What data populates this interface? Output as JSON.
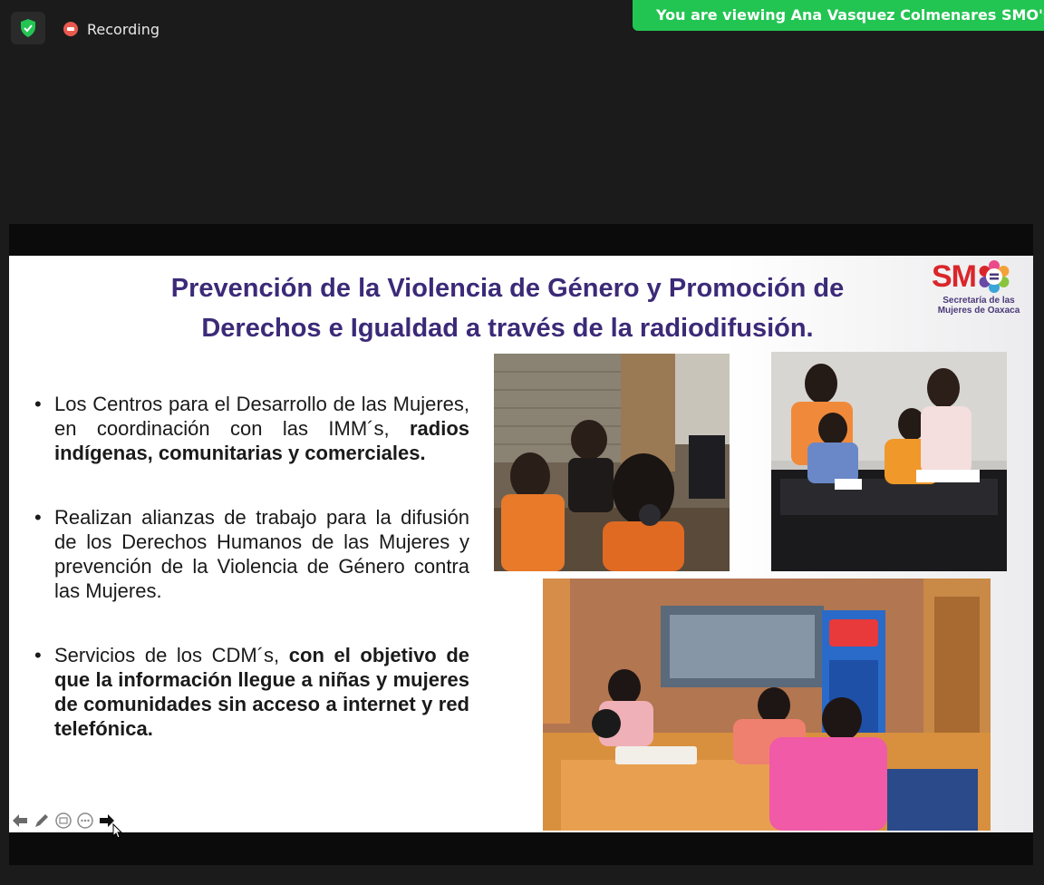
{
  "topbar": {
    "recording_label": "Recording",
    "viewing_label": "You are viewing Ana Vasquez Colmenares SMO's",
    "icons": [
      "shield-check-icon",
      "recording-icon"
    ],
    "accent_color": "#23c552"
  },
  "slide": {
    "title_line1": "Prevención de la Violencia de Género y Promoción de",
    "title_line2": "Derechos e Igualdad a través de la radiodifusión.",
    "logo": {
      "initials": "SM",
      "subtitle_line1": "Secretaría de las",
      "subtitle_line2": "Mujeres de Oaxaca"
    },
    "bullets": [
      {
        "plain": "Los Centros para el Desarrollo de las Mujeres, en coordinación con las IMM´s,",
        "bold": " radios indígenas, comunitarias y comerciales."
      },
      {
        "plain": "Realizan alianzas de trabajo para la difusión de los Derechos Humanos de las Mujeres y prevención de la Violencia de Género contra las Mujeres.",
        "bold": ""
      },
      {
        "plain": "Servicios de los CDM´s,",
        "bold": " con el objetivo de que la información llegue a niñas y mujeres de comunidades sin acceso a internet y red telefónica."
      }
    ],
    "photos": [
      "radio-booth-photo",
      "radio-table-photo",
      "radio-studio-photo"
    ],
    "toolbar_icons": [
      "arrow-left-icon",
      "pen-icon",
      "slides-icon",
      "more-icon",
      "arrow-right-icon"
    ],
    "title_color": "#3c2a78"
  }
}
